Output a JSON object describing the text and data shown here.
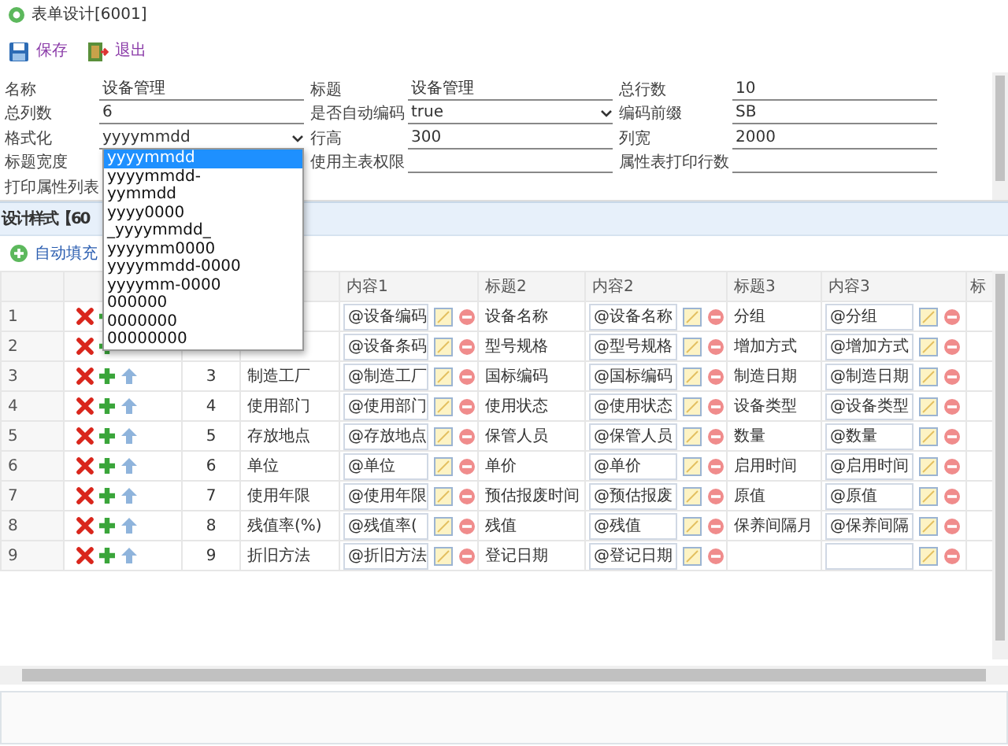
{
  "window": {
    "title": "表单设计[6001]"
  },
  "toolbar": [
    {
      "label": "保存",
      "kind": "save"
    },
    {
      "label": "退出",
      "kind": "exit"
    }
  ],
  "form": {
    "rows": [
      [
        {
          "label": "名称",
          "value": "设备管理",
          "kind": "text"
        },
        {
          "label": "标题",
          "value": "设备管理",
          "kind": "text"
        },
        {
          "label": "总行数",
          "value": "10",
          "kind": "text"
        }
      ],
      [
        {
          "label": "总列数",
          "value": "6",
          "kind": "text"
        },
        {
          "label": "是否自动编码",
          "value": "true",
          "kind": "select"
        },
        {
          "label": "编码前缀",
          "value": "SB",
          "kind": "text"
        }
      ],
      [
        {
          "label": "格式化",
          "value": "yyyymmdd",
          "kind": "select"
        },
        {
          "label": "行高",
          "value": "300",
          "kind": "text"
        },
        {
          "label": "列宽",
          "value": "2000",
          "kind": "text"
        }
      ],
      [
        {
          "label": "标题宽度",
          "kind": "hidden"
        },
        {
          "label": "使用主表权限",
          "kind": "text"
        },
        {
          "label": "属性表打印行数",
          "kind": "text"
        }
      ],
      [
        {
          "label": "打印属性列表",
          "kind": "hidden"
        }
      ]
    ]
  },
  "dropdown": {
    "options": [
      {
        "label": "yyyymmdd",
        "selected": true
      },
      {
        "label": "yyyymmdd-",
        "selected": false
      },
      {
        "label": "yymmdd",
        "selected": false
      },
      {
        "label": "yyyy0000",
        "selected": false
      },
      {
        "label": "_yyyymmdd_",
        "selected": false
      },
      {
        "label": "yyyymm0000",
        "selected": false
      },
      {
        "label": "yyyymmdd-0000",
        "selected": false
      },
      {
        "label": "yyyymm-0000",
        "selected": false
      },
      {
        "label": "000000",
        "selected": false
      },
      {
        "label": "0000000",
        "selected": false
      },
      {
        "label": "00000000",
        "selected": false
      }
    ]
  },
  "design": {
    "title": "设计样式【60",
    "toolbar": [
      {
        "label": "自动填充"
      }
    ],
    "columns": [
      "内容1",
      "标题2",
      "内容2",
      "标题3",
      "内容3",
      "标"
    ],
    "rows": [
      {
        "number": "1",
        "actions": [
          {
            "kind": "delete"
          },
          {
            "kind": "add"
          }
        ],
        "pairs": [
          {
            "content": "@设备编码"
          },
          {
            "title": "设备名称",
            "content": "@设备名称"
          },
          {
            "title": "分组",
            "content": "@分组"
          }
        ]
      },
      {
        "number": "2",
        "actions": [
          {
            "kind": "delete"
          },
          {
            "kind": "add"
          }
        ],
        "pairs": [
          {
            "content": "@设备条码"
          },
          {
            "title": "型号规格",
            "content": "@型号规格"
          },
          {
            "title": "增加方式",
            "content": "@增加方式"
          }
        ]
      },
      {
        "number": "3",
        "actions": [
          {
            "kind": "delete"
          },
          {
            "kind": "add"
          },
          {
            "kind": "move"
          }
        ],
        "seq": "3",
        "pairs": [
          {
            "title": "制造工厂",
            "content": "@制造工厂"
          },
          {
            "title": "国标编码",
            "content": "@国标编码"
          },
          {
            "title": "制造日期",
            "content": "@制造日期"
          }
        ]
      },
      {
        "number": "4",
        "actions": [
          {
            "kind": "delete"
          },
          {
            "kind": "add"
          },
          {
            "kind": "move"
          }
        ],
        "seq": "4",
        "pairs": [
          {
            "title": "使用部门",
            "content": "@使用部门"
          },
          {
            "title": "使用状态",
            "content": "@使用状态"
          },
          {
            "title": "设备类型",
            "content": "@设备类型"
          }
        ]
      },
      {
        "number": "5",
        "actions": [
          {
            "kind": "delete"
          },
          {
            "kind": "add"
          },
          {
            "kind": "move"
          }
        ],
        "seq": "5",
        "pairs": [
          {
            "title": "存放地点",
            "content": "@存放地点"
          },
          {
            "title": "保管人员",
            "content": "@保管人员"
          },
          {
            "title": "数量",
            "content": "@数量"
          }
        ]
      },
      {
        "number": "6",
        "actions": [
          {
            "kind": "delete"
          },
          {
            "kind": "add"
          },
          {
            "kind": "move"
          }
        ],
        "seq": "6",
        "pairs": [
          {
            "title": "单位",
            "content": "@单位"
          },
          {
            "title": "单价",
            "content": "@单价"
          },
          {
            "title": "启用时间",
            "content": "@启用时间"
          }
        ]
      },
      {
        "number": "7",
        "actions": [
          {
            "kind": "delete"
          },
          {
            "kind": "add"
          },
          {
            "kind": "move"
          }
        ],
        "seq": "7",
        "pairs": [
          {
            "title": "使用年限",
            "content": "@使用年限"
          },
          {
            "title": "预估报废时间",
            "content": "@预估报废"
          },
          {
            "title": "原值",
            "content": "@原值"
          }
        ]
      },
      {
        "number": "8",
        "actions": [
          {
            "kind": "delete"
          },
          {
            "kind": "add"
          },
          {
            "kind": "move"
          }
        ],
        "seq": "8",
        "pairs": [
          {
            "title": "残值率(%)",
            "content": "@残值率("
          },
          {
            "title": "残值",
            "content": "@残值"
          },
          {
            "title": "保养间隔月",
            "content": "@保养间隔"
          }
        ]
      },
      {
        "number": "9",
        "actions": [
          {
            "kind": "delete"
          },
          {
            "kind": "add"
          },
          {
            "kind": "move"
          }
        ],
        "seq": "9",
        "pairs": [
          {
            "title": "折旧方法",
            "content": "@折旧方法"
          },
          {
            "title": "登记日期",
            "content": "@登记日期"
          }
        ]
      }
    ]
  }
}
